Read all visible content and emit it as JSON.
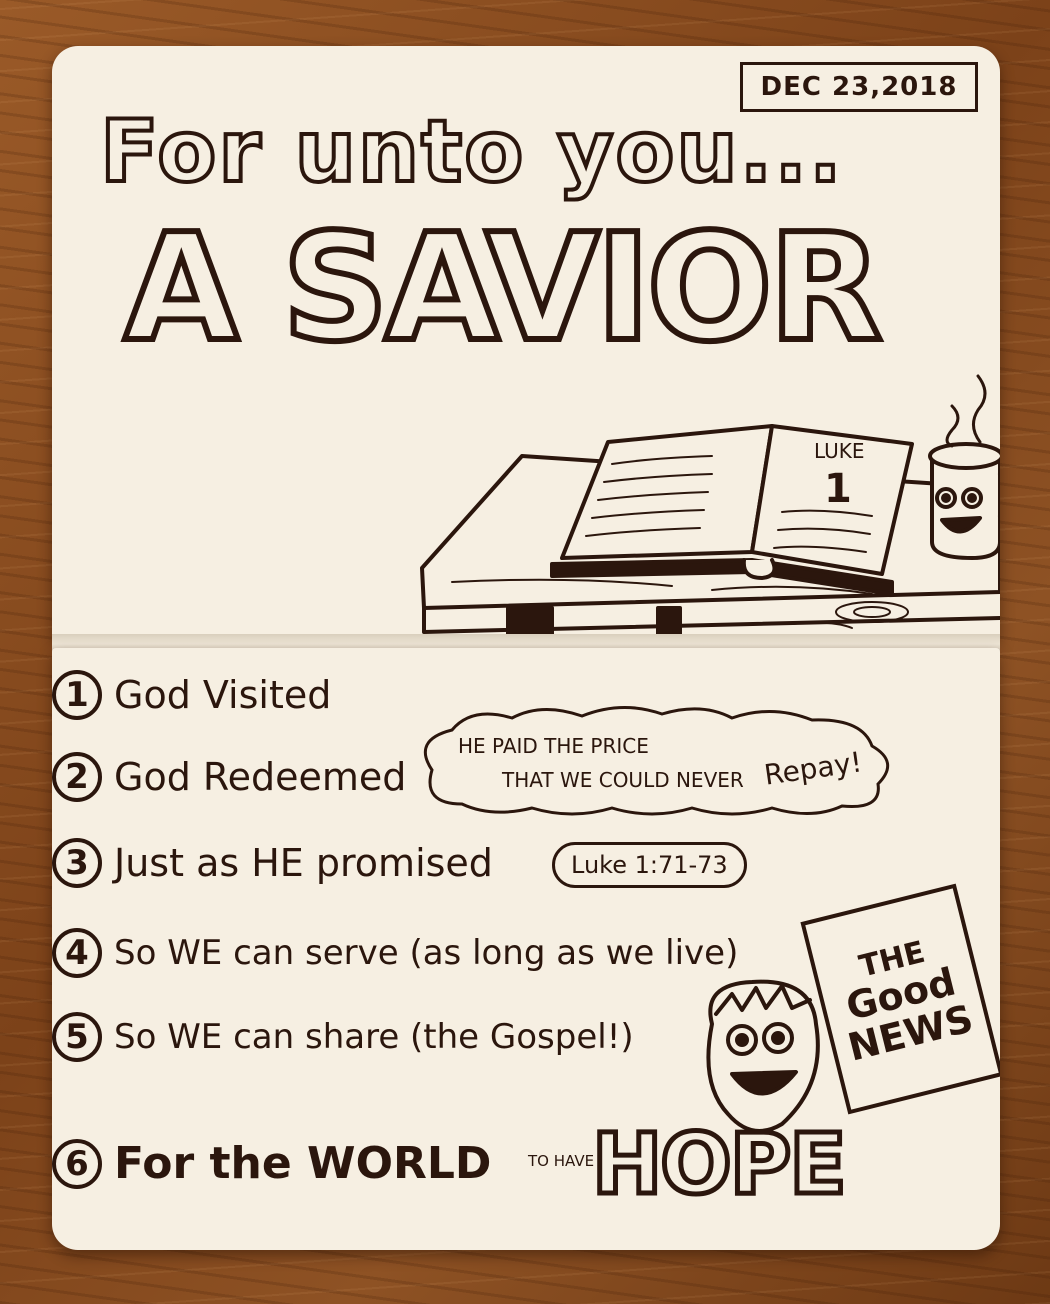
{
  "top_page": {
    "date": "DEC 23,2018",
    "title_line": "For unto you...",
    "headline": "A SAVIOR",
    "book_label": "LUKE",
    "book_chapter": "1"
  },
  "bottom_page": {
    "items": [
      {
        "number": "1",
        "text": "God Visited"
      },
      {
        "number": "2",
        "text": "God Redeemed"
      },
      {
        "number": "3",
        "text": "Just as HE promised"
      },
      {
        "number": "4",
        "text": "So WE can serve (as long as we live)"
      },
      {
        "number": "5",
        "text": "So WE can share (the Gospel!)"
      },
      {
        "number": "6",
        "text": "For the WORLD"
      }
    ],
    "cloud_line1": "HE PAID THE PRICE",
    "cloud_line2": "THAT WE COULD NEVER",
    "cloud_repay": "Repay!",
    "reference": "Luke 1:71-73",
    "to_have": "TO HAVE",
    "hope": "HOPE",
    "good_news": {
      "line1": "THE",
      "line2": "Good",
      "line3": "NEWS"
    }
  },
  "colors": {
    "ink": "#2b160d",
    "paper": "#f6efe2",
    "wood": "#8a4e21"
  }
}
